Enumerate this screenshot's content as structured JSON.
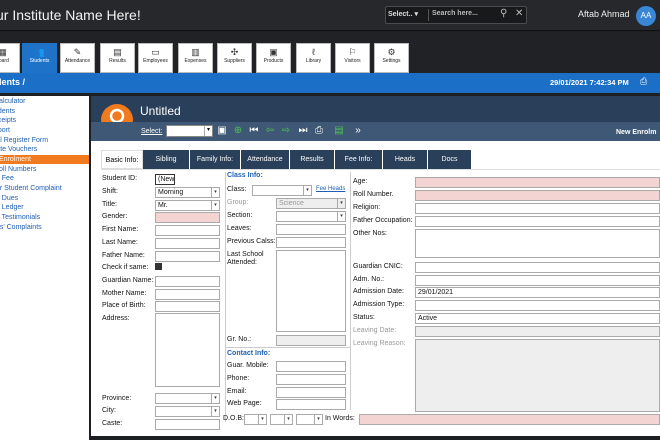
{
  "topbar": {
    "institute_name": "ur Institute Name Here!",
    "search_select": "Select..",
    "search_placeholder": "Search here...",
    "user_name": "Aftab Ahmad",
    "avatar_initials": "AA"
  },
  "modules": [
    {
      "label": "board",
      "icon": "dashboard-icon"
    },
    {
      "label": "Students",
      "icon": "students-icon",
      "active": true
    },
    {
      "label": "Attendance",
      "icon": "attendance-icon"
    },
    {
      "label": "Results",
      "icon": "results-icon"
    },
    {
      "label": "Employees",
      "icon": "employees-icon"
    },
    {
      "label": "Expenses",
      "icon": "expenses-icon"
    },
    {
      "label": "Suppliers",
      "icon": "suppliers-icon"
    },
    {
      "label": "Products",
      "icon": "products-icon"
    },
    {
      "label": "Library",
      "icon": "library-icon"
    },
    {
      "label": "Visitors",
      "icon": "visitors-icon"
    },
    {
      "label": "Settings",
      "icon": "settings-icon"
    }
  ],
  "breadcrumb": "dents /",
  "datetime": "29/01/2021 7:42:34 PM",
  "sidebar": [
    {
      "label": "Calculator"
    },
    {
      "label": "udents"
    },
    {
      "label": "eceipts"
    },
    {
      "label": "eport"
    },
    {
      "label": "ral Register Form"
    },
    {
      "label": "rate Vouchers"
    },
    {
      "label": "Enrolment",
      "active": true
    },
    {
      "label": "Roll Numbers"
    },
    {
      "label": "pt Fee"
    },
    {
      "label": "ter Student Complaint"
    },
    {
      "label": "nt Dues"
    },
    {
      "label": "nt Ledger"
    },
    {
      "label": "nt Testimonials"
    },
    {
      "label": "nts' Complaints"
    }
  ],
  "header": {
    "title": "Untitled",
    "select_label": "Select:",
    "new_enrolment": "New Enrolm"
  },
  "tabs": [
    {
      "label": "Basic Info:",
      "active": true
    },
    {
      "label": "Sibling"
    },
    {
      "label": "Family Info:"
    },
    {
      "label": "Attendance"
    },
    {
      "label": "Results"
    },
    {
      "label": "Fee Info:"
    },
    {
      "label": "Heads"
    },
    {
      "label": "Docs"
    }
  ],
  "form": {
    "student_id_label": "Student ID:",
    "student_id_value": "(New)",
    "shift_label": "Shift:",
    "shift_value": "Morning",
    "title_label": "Title:",
    "title_value": "Mr.",
    "gender_label": "Gender:",
    "first_name_label": "First Name:",
    "last_name_label": "Last Name:",
    "father_name_label": "Father Name:",
    "check_same_label": "Check if same:",
    "guardian_name_label": "Guardian Name:",
    "mother_name_label": "Mother Name:",
    "place_birth_label": "Place of Birth:",
    "address_label": "Address:",
    "province_label": "Province:",
    "city_label": "City:",
    "caste_label": "Caste:",
    "class_info_heading": "Class Info:",
    "class_label": "Class:",
    "fee_heads_link": "Fee Heads",
    "group_label": "Group:",
    "group_value": "Science",
    "section_label": "Section:",
    "leaves_label": "Leaves:",
    "previous_class_label": "Previous Calss:",
    "last_school_label": "Last School",
    "last_school_label2": "Attended:",
    "gr_no_label": "Gr. No.:",
    "contact_info_heading": "Contact Info:",
    "guar_mobile_label": "Guar. Mobile:",
    "phone_label": "Phone:",
    "email_label": "Email:",
    "web_page_label": "Web Page:",
    "dob_label": "D.O.B:",
    "in_words_label": "In Words:",
    "age_label": "Age:",
    "roll_number_label": "Roll Number.",
    "religion_label": "Religion:",
    "father_occupation_label": "Father Occupation:",
    "other_nos_label": "Other Nos:",
    "guardian_cnic_label": "Guardian CNIC:",
    "adm_no_label": "Adm. No.:",
    "admission_date_label": "Admission Date:",
    "admission_date_value": "29/01/2021",
    "admission_type_label": "Admission Type:",
    "status_label": "Status:",
    "status_value": "Active",
    "leaving_date_label": "Leaving Date:",
    "leaving_reason_label": "Leaving Reason:"
  },
  "colors": {
    "accent_blue": "#1c6fc6",
    "accent_orange": "#f07a1d",
    "header_navy": "#2a3f59",
    "required_pink": "#f4d3d3"
  }
}
